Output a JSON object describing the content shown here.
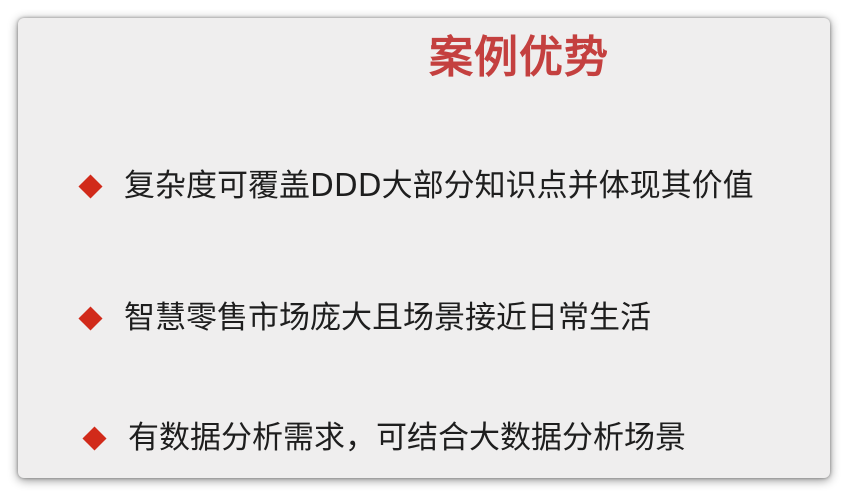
{
  "slide": {
    "title": "案例优势",
    "bullets": [
      "复杂度可覆盖DDD大部分知识点并体现其价值",
      "智慧零售市场庞大且场景接近日常生活",
      "有数据分析需求，可结合大数据分析场景"
    ]
  },
  "colors": {
    "title": "#c4403f",
    "bullet_marker": "#d12a1a",
    "background": "#efeeee"
  },
  "icons": {
    "bullet_marker": "diamond-icon"
  }
}
